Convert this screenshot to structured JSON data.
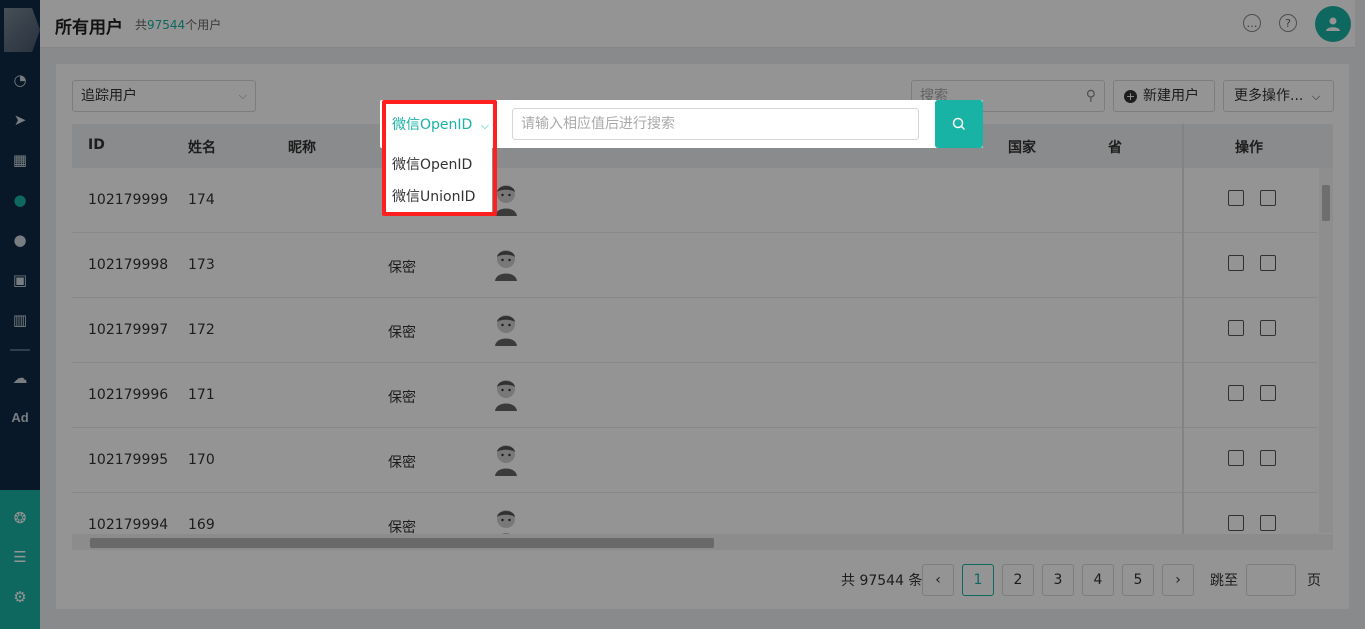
{
  "sidebar": {
    "icons": [
      "dashboard-icon",
      "send-icon",
      "layout-icon",
      "user-icon",
      "users-icon",
      "bookmark-icon",
      "bar-chart-icon",
      "wechat-icon",
      "ad-icon"
    ],
    "ad_label": "Ad",
    "bottom_icons": [
      "hub-icon",
      "server-icon",
      "gear-icon"
    ],
    "active": "user-icon"
  },
  "header": {
    "title": "所有用户",
    "count_prefix": "共",
    "count_value": "97544",
    "count_suffix": "个用户"
  },
  "toolbar": {
    "track_select": "追踪用户",
    "search_placeholder": "搜索",
    "new_user": "新建用户",
    "more_actions": "更多操作..."
  },
  "table": {
    "columns": [
      "ID",
      "姓名",
      "昵称",
      "国家",
      "省",
      "操作"
    ],
    "rows": [
      {
        "id": "102179999",
        "name": "174",
        "gender": ""
      },
      {
        "id": "102179998",
        "name": "173",
        "gender": "保密"
      },
      {
        "id": "102179997",
        "name": "172",
        "gender": "保密"
      },
      {
        "id": "102179996",
        "name": "171",
        "gender": "保密"
      },
      {
        "id": "102179995",
        "name": "170",
        "gender": "保密"
      },
      {
        "id": "102179994",
        "name": "169",
        "gender": "保密"
      }
    ]
  },
  "pagination": {
    "total": "共 97544 条",
    "pages": [
      "1",
      "2",
      "3",
      "4",
      "5"
    ],
    "current": "1",
    "jump_label": "跳至",
    "page_unit": "页"
  },
  "search_popup": {
    "type_selected": "微信OpenID",
    "placeholder": "请输入相应值后进行搜索",
    "options": [
      "微信OpenID",
      "微信UnionID"
    ]
  },
  "colors": {
    "accent": "#19b3a6",
    "sidebar": "#0e2a47",
    "highlight": "#ff1f1f"
  }
}
